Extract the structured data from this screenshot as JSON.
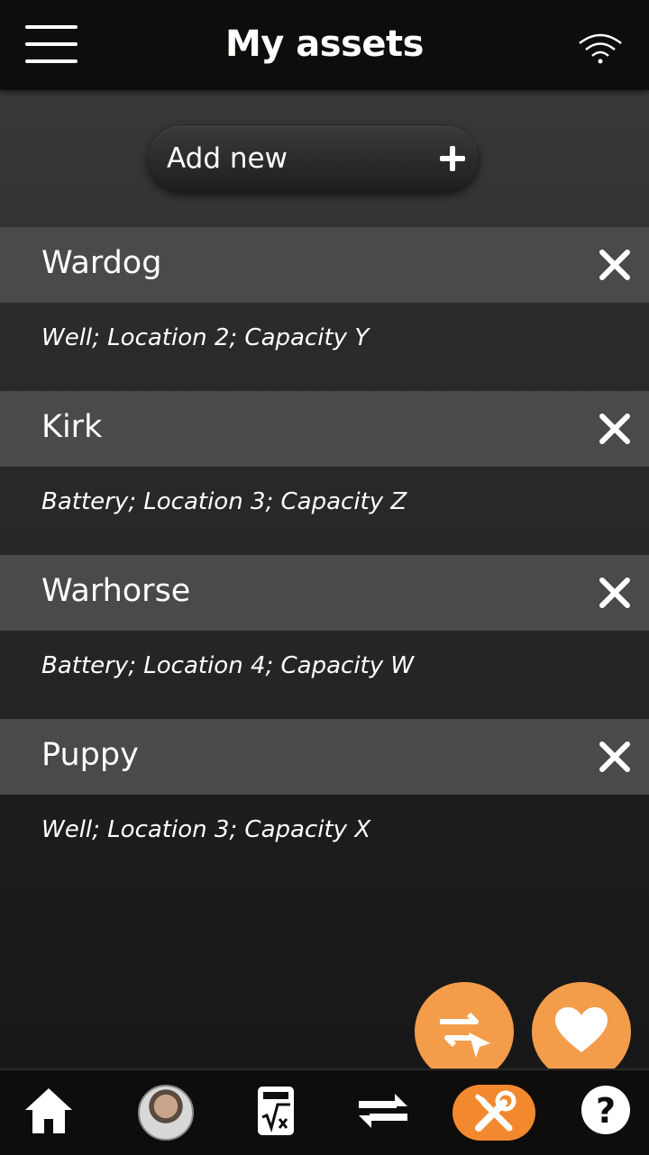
{
  "header": {
    "title": "My assets",
    "menu_icon": "hamburger-menu-icon",
    "status_icon": "wifi-icon"
  },
  "add_button": {
    "label": "Add new"
  },
  "assets": [
    {
      "name": "Wardog",
      "description": "Well; Location 2; Capacity Y"
    },
    {
      "name": "Kirk",
      "description": "Battery; Location 3; Capacity Z"
    },
    {
      "name": "Warhorse",
      "description": "Battery; Location 4; Capacity W"
    },
    {
      "name": "Puppy",
      "description": "Well; Location 3; Capacity X"
    }
  ],
  "fabs": [
    "transfer-icon",
    "heart-icon"
  ],
  "bottom_nav": [
    "home-icon",
    "avatar",
    "calculator-icon",
    "transfer-icon",
    "tools-icon",
    "help-icon"
  ],
  "colors": {
    "accent": "#f39c4a",
    "active_nav": "#f3892e",
    "bar": "#0f0c0c",
    "row_header": "#4a4a4a"
  }
}
